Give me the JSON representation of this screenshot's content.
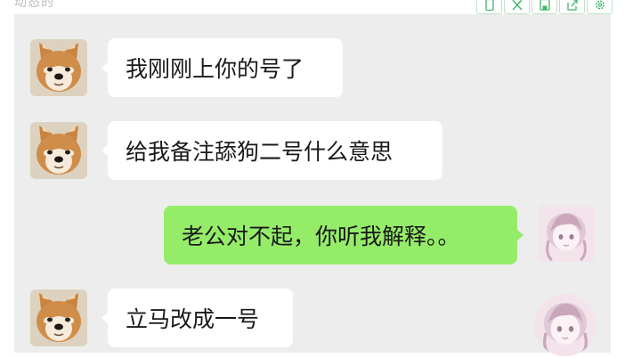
{
  "window": {
    "title_fragment": "动态的"
  },
  "toolbar": {
    "buttons": [
      {
        "icon": "mobile-icon"
      },
      {
        "icon": "crop-icon"
      },
      {
        "icon": "save-icon"
      },
      {
        "icon": "share-icon"
      },
      {
        "icon": "gear-icon"
      }
    ]
  },
  "chat": {
    "messages": [
      {
        "sender": "other",
        "avatar": "shiba-dog-avatar",
        "text": "我刚刚上你的号了"
      },
      {
        "sender": "other",
        "avatar": "shiba-dog-avatar",
        "text": "给我备注舔狗二号什么意思"
      },
      {
        "sender": "self",
        "avatar": "anime-girl-avatar",
        "text": "老公对不起，你听我解释。。"
      },
      {
        "sender": "other",
        "avatar": "shiba-dog-avatar",
        "text": "立马改成一号"
      }
    ]
  },
  "colors": {
    "chat_background": "#ededed",
    "bubble_other": "#ffffff",
    "bubble_self": "#95ec69",
    "text": "#191919"
  }
}
